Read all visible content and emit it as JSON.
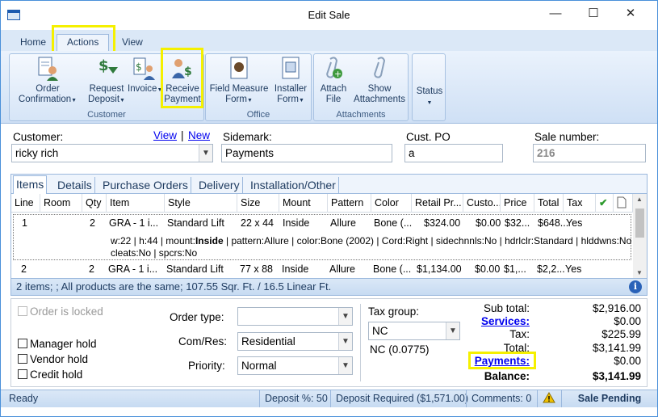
{
  "window": {
    "title": "Edit Sale",
    "controls": {
      "minimize": "—",
      "maximize": "☐",
      "close": "✕"
    }
  },
  "ribbon_tabs": [
    "Home",
    "Actions",
    "View"
  ],
  "ribbon": {
    "groups": {
      "customer": {
        "label": "Customer",
        "order_confirmation": "Order\nConfirmation",
        "request_deposit": "Request\nDeposit",
        "invoice": "Invoice",
        "receive_payment": "Receive\nPayment"
      },
      "office": {
        "label": "Office",
        "field_measure": "Field Measure\nForm",
        "installer": "Installer\nForm"
      },
      "attachments": {
        "label": "Attachments",
        "attach_file": "Attach\nFile",
        "show_attachments": "Show\nAttachments"
      },
      "status": {
        "label": "Status"
      }
    }
  },
  "fields": {
    "customer_label": "Customer:",
    "customer_value": "ricky rich",
    "view_link": "View",
    "new_link": "New",
    "sidemark_label": "Sidemark:",
    "sidemark_value": "Payments",
    "cust_po_label": "Cust. PO",
    "cust_po_value": "a",
    "sale_number_label": "Sale number:",
    "sale_number_value": "216"
  },
  "grid": {
    "tabs": [
      "Items",
      "Details",
      "Purchase Orders",
      "Delivery",
      "Installation/Other"
    ],
    "columns": [
      "Line",
      "Room",
      "Qty",
      "Item",
      "Style",
      "Size",
      "Mount",
      "Pattern",
      "Color",
      "Retail Pr...",
      "Custo...",
      "Price",
      "Total",
      "Tax"
    ],
    "rows": [
      {
        "line": "1",
        "room": "",
        "qty": "2",
        "item": "GRA - 1 i...",
        "style": "Standard Lift",
        "size": "22 x 44",
        "mount": "Inside",
        "pattern": "Allure",
        "color": "Bone (...",
        "retail": "$324.00",
        "custom": "$0.00",
        "price": "$32...",
        "total": "$648...",
        "tax": "Yes",
        "detail_pre": "w:22 | h:44 | mount:",
        "detail_bold": "Inside",
        "detail_post": " | pattern:Allure | color:Bone (2002) | Cord:Right | sidechnnls:No | hdrlclr:Standard | hlddwns:No |",
        "detail_line2": "cleats:No | spcrs:No"
      },
      {
        "line": "2",
        "room": "",
        "qty": "2",
        "item": "GRA - 1 i...",
        "style": "Standard Lift",
        "size": "77 x 88",
        "mount": "Inside",
        "pattern": "Allure",
        "color": "Bone (...",
        "retail": "$1,134.00",
        "custom": "$0.00",
        "price": "$1,...",
        "total": "$2,2...",
        "tax": "Yes"
      }
    ],
    "footer": "2 items; ; All products are the same; 107.55 Sqr. Ft. / 16.5 Linear Ft."
  },
  "bottom": {
    "order_locked": "Order is locked",
    "manager_hold": "Manager hold",
    "vendor_hold": "Vendor hold",
    "credit_hold": "Credit hold",
    "order_type_label": "Order type:",
    "order_type_value": "",
    "com_res_label": "Com/Res:",
    "com_res_value": "Residential",
    "priority_label": "Priority:",
    "priority_value": "Normal",
    "tax_group_label": "Tax group:",
    "tax_group_value": "NC",
    "tax_rate": "NC (0.0775)"
  },
  "totals": {
    "subtotal_label": "Sub total:",
    "subtotal": "$2,916.00",
    "services_label": "Services:",
    "services": "$0.00",
    "tax_label": "Tax:",
    "tax": "$225.99",
    "total_label": "Total:",
    "total": "$3,141.99",
    "payments_label": "Payments:",
    "payments": "$0.00",
    "balance_label": "Balance:",
    "balance": "$3,141.99"
  },
  "statusbar": {
    "ready": "Ready",
    "deposit_pct": "Deposit %: 50",
    "deposit_required": "Deposit Required ($1,571.00)",
    "comments": "Comments: 0",
    "sale_status": "Sale Pending"
  },
  "colors": {
    "accent": "#1d3a5f",
    "highlight": "#f5f000",
    "link": "#0000ee"
  }
}
